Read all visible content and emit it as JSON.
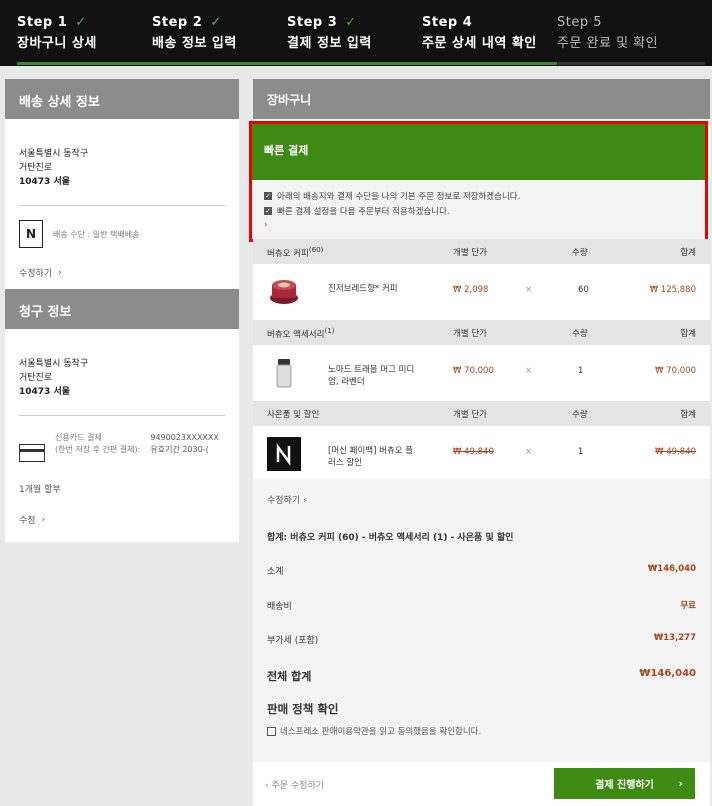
{
  "steps": [
    {
      "num": "Step 1",
      "title": "장바구니 상세",
      "done": true
    },
    {
      "num": "Step 2",
      "title": "배송 정보 입력",
      "done": true
    },
    {
      "num": "Step 3",
      "title": "결제 정보 입력",
      "done": true
    },
    {
      "num": "Step 4",
      "title": "주문 상세 내역 확인",
      "done": false
    },
    {
      "num": "Step 5",
      "title": "주문 완료 및 확인",
      "done": false
    }
  ],
  "shipping": {
    "header": "배송 상세 정보",
    "addr1": "서울특별시 동작구",
    "addr2": "거탄진로",
    "addr3": "10473 서울",
    "method": "배송 수단 : 일반 택배배송",
    "edit": "수정하기"
  },
  "billing": {
    "header": "청구 정보",
    "addr1": "서울특별시 동작구",
    "addr2": "거탄진로",
    "addr3": "10473 서울",
    "pay_label": "신용카드 결제",
    "pay_note": "(한번 저장 후 간편 결제):",
    "card_no": "9490023XXXXXX",
    "expiry": "유효기간 2030-(",
    "installment": "1개월 할부",
    "edit": "수정"
  },
  "cart": {
    "header": "장바구니",
    "fast_title": "빠른 결제",
    "fast_opt1": "아래의 배송지와 결제 수단을 나의 기본 주문 정보로 저장하겠습니다.",
    "fast_opt2": "빠른 결제 설정을 다음 주문부터 적용하겠습니다.",
    "col_unit": "개별 단가",
    "col_qty": "수량",
    "col_total": "합계",
    "groups": [
      {
        "name": "버츄오 커피",
        "count": "(60)",
        "item": "진저브레드향* 커피",
        "price": "₩ 2,098",
        "qty": "60",
        "total": "₩ 125,880"
      },
      {
        "name": "버츄오 액세서리",
        "count": "(1)",
        "item": "노마드 트래블 머그 미디엄, 라벤더",
        "price": "₩ 70,000",
        "qty": "1",
        "total": "₩ 70,000"
      },
      {
        "name": "사은품 및 할인",
        "count": "",
        "item": "[머신 페이백] 버츄오 플러스 할인",
        "price": "₩ 49,840",
        "qty": "1",
        "total": "₩ 49,840"
      }
    ],
    "times": "×",
    "edit": "수정하기",
    "summary": "합계: 버츄오 커피 (60) - 버츄오 액세서리 (1) - 사은품 및 할인",
    "subtotal_label": "소계",
    "subtotal": "₩146,040",
    "shipping_label": "배송비",
    "shipping_value": "무료",
    "vat_label": "부가세 (포함)",
    "vat": "₩13,277",
    "total_label": "전체 합계",
    "total": "₩146,040",
    "policy_title": "판매 정책 확인",
    "policy_text": "네스프레소 판매이용약관을 읽고 동의했음을 확인합니다.",
    "back": "주문 수정하기",
    "proceed": "결제 진행하기"
  }
}
